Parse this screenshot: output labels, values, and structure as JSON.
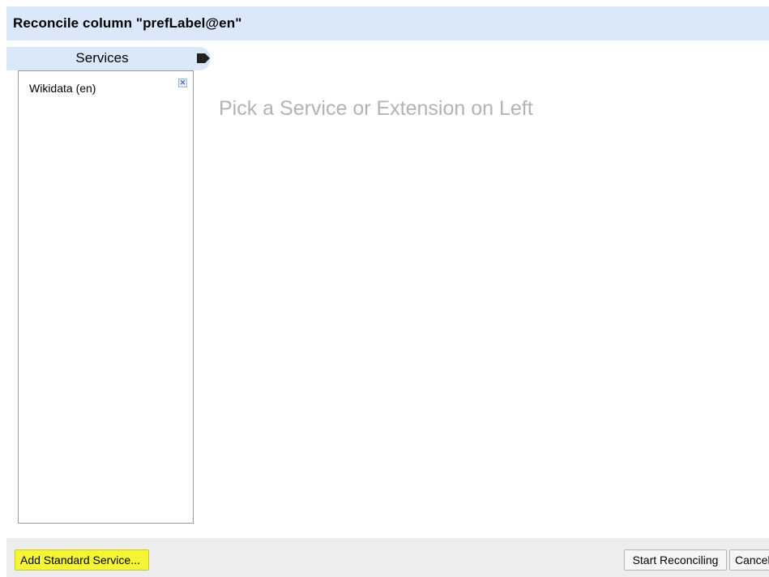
{
  "dialog": {
    "title": "Reconcile column \"prefLabel@en\""
  },
  "services": {
    "header": "Services",
    "header_icon": "tag-icon",
    "items": [
      {
        "label": "Wikidata (en)",
        "remove_icon": "close-icon"
      }
    ]
  },
  "main": {
    "placeholder": "Pick a Service or Extension on Left"
  },
  "footer": {
    "add_label": "Add Standard Service...",
    "start_label": "Start Reconciling",
    "cancel_label": "Cancel"
  },
  "colors": {
    "header_bg": "#dbe8fa",
    "footer_bg": "#ededed",
    "highlight": "#f5f536",
    "placeholder_text": "#b3b3b3"
  }
}
